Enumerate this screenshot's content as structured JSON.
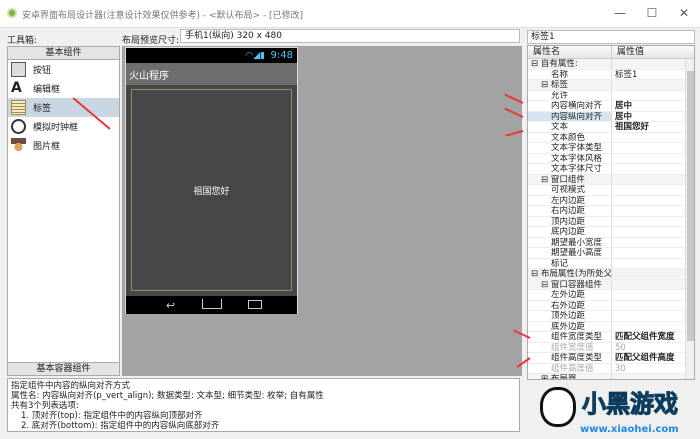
{
  "window": {
    "title": "安卓界面布局设计器(注意设计效果仅供参考) - <默认布局> - [已修改]",
    "controls": [
      "—",
      "☐",
      "✕"
    ]
  },
  "toolbox": {
    "label": "工具箱:",
    "header": "基本组件",
    "footer": "基本容器组件",
    "items": [
      {
        "label": "按钮",
        "icon": "button-icon"
      },
      {
        "label": "编辑框",
        "icon": "edit-box-icon"
      },
      {
        "label": "标签",
        "icon": "label-icon",
        "selected": true
      },
      {
        "label": "模拟时钟框",
        "icon": "clock-icon"
      },
      {
        "label": "图片框",
        "icon": "image-icon"
      }
    ]
  },
  "preview": {
    "label": "布局预览尺寸:",
    "size": "手机1(纵向) 320 x 480",
    "clock": "9:48",
    "app_title": "火山程序",
    "label_text": "祖国您好"
  },
  "properties": {
    "title": "标签1",
    "col_name": "属性名",
    "col_value": "属性值",
    "rows": [
      {
        "n": "⊟ 自有属性:",
        "v": "",
        "t": "grp",
        "i": 0
      },
      {
        "n": "名称",
        "v": "标签1",
        "i": 2,
        "plain": true
      },
      {
        "n": "⊟ 标签",
        "v": "",
        "t": "grp",
        "i": 1
      },
      {
        "n": "允许",
        "v": "",
        "i": 2
      },
      {
        "n": "内容横向对齐",
        "v": "居中",
        "i": 2
      },
      {
        "n": "内容纵向对齐",
        "v": "居中",
        "i": 2,
        "t": "sel"
      },
      {
        "n": "文本",
        "v": "祖国您好",
        "i": 2
      },
      {
        "n": "文本颜色",
        "v": "",
        "i": 2
      },
      {
        "n": "文本字体类型",
        "v": "",
        "i": 2
      },
      {
        "n": "文本字体风格",
        "v": "",
        "i": 2
      },
      {
        "n": "文本字体尺寸",
        "v": "",
        "i": 2
      },
      {
        "n": "⊟ 窗口组件",
        "v": "",
        "t": "grp",
        "i": 1
      },
      {
        "n": "可视模式",
        "v": "",
        "i": 2
      },
      {
        "n": "左内边距",
        "v": "",
        "i": 2
      },
      {
        "n": "右内边距",
        "v": "",
        "i": 2
      },
      {
        "n": "顶内边距",
        "v": "",
        "i": 2
      },
      {
        "n": "底内边距",
        "v": "",
        "i": 2
      },
      {
        "n": "期望最小宽度",
        "v": "",
        "i": 2
      },
      {
        "n": "期望最小高度",
        "v": "",
        "i": 2
      },
      {
        "n": "标记",
        "v": "",
        "i": 2
      },
      {
        "n": "⊟ 布局属性(为所处父组件提供):",
        "v": "",
        "t": "grp",
        "i": 0
      },
      {
        "n": "⊟ 窗口容器组件",
        "v": "",
        "t": "grp",
        "i": 1
      },
      {
        "n": "左外边距",
        "v": "",
        "i": 2
      },
      {
        "n": "右外边距",
        "v": "",
        "i": 2
      },
      {
        "n": "顶外边距",
        "v": "",
        "i": 2
      },
      {
        "n": "底外边距",
        "v": "",
        "i": 2
      },
      {
        "n": "组件宽度类型",
        "v": "匹配父组件宽度",
        "i": 2
      },
      {
        "n": "组件宽度值",
        "v": "50",
        "i": 2,
        "t": "dis"
      },
      {
        "n": "组件高度类型",
        "v": "匹配父组件高度",
        "i": 2
      },
      {
        "n": "组件高度值",
        "v": "30",
        "i": 2,
        "t": "dis"
      },
      {
        "n": "⊞ 布局器",
        "v": "",
        "t": "grp",
        "i": 1
      }
    ]
  },
  "description": {
    "lines": [
      "指定组件中内容的纵向对齐方式",
      "属性名: 内容纵向对齐(p_vert_align); 数据类型: 文本型; 细节类型: 枚举; 自有属性",
      "共有3个列表选项:"
    ],
    "options": [
      "1. 顶对齐(top): 指定组件中的内容纵向顶部对齐",
      "2. 底对齐(bottom): 指定组件中的内容纵向底部对齐"
    ]
  },
  "watermark": {
    "text": "小黑游戏",
    "url": "www.xiaohei.com"
  },
  "colors": {
    "arrow": "#e53935",
    "selection": "#c9d6e4"
  }
}
